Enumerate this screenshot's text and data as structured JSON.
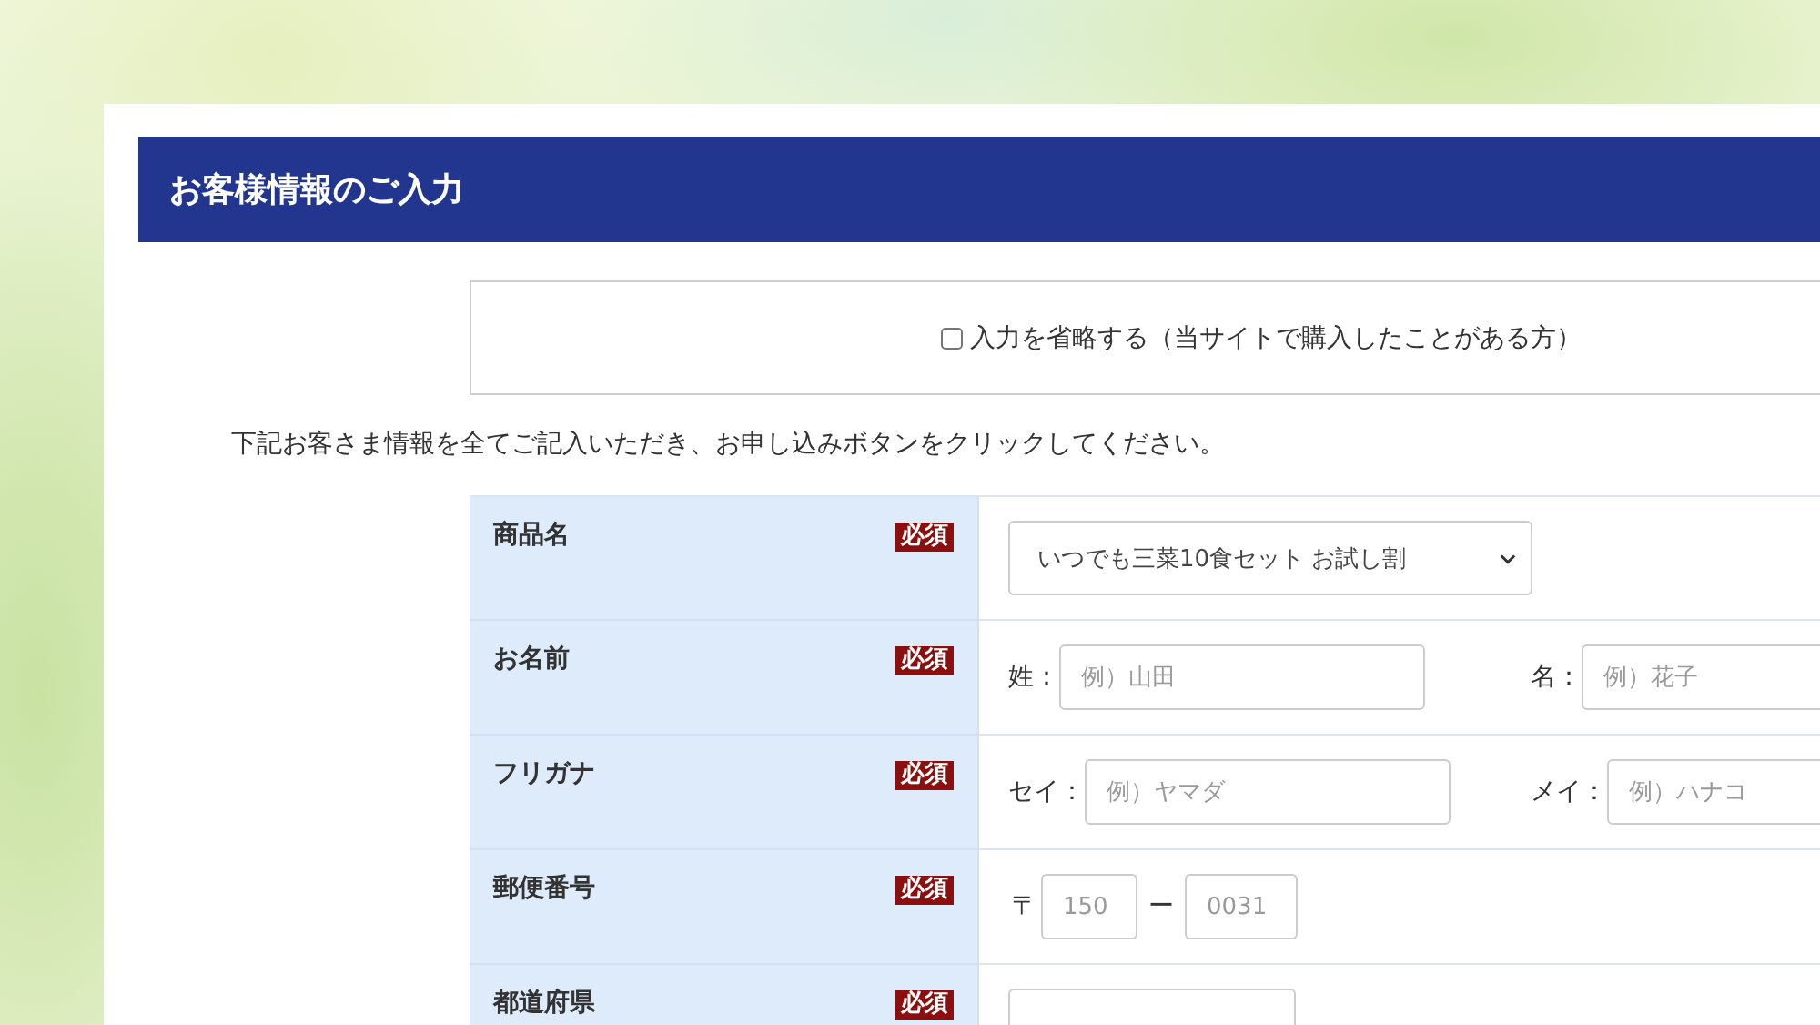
{
  "page_title": "お客様情報のご入力",
  "skip_input": {
    "label": "入力を省略する（当サイトで購入したことがある方）",
    "checked": false
  },
  "instructions": "下記お客さま情報を全てご記入いただき、お申し込みボタンをクリックしてください。",
  "form_rows": [
    {
      "label": "商品名",
      "badge": "必須",
      "kind": "select",
      "value": "いつでも三菜10食セット お試し割"
    },
    {
      "label": "お名前",
      "badge": "必須",
      "kind": "pair",
      "fields": [
        {
          "label": "姓：",
          "placeholder": "例）山田"
        },
        {
          "label": "名：",
          "placeholder": "例）花子"
        }
      ]
    },
    {
      "label": "フリガナ",
      "badge": "必須",
      "kind": "pair",
      "fields": [
        {
          "label": "セイ：",
          "placeholder": "例）ヤマダ"
        },
        {
          "label": "メイ：",
          "placeholder": "例）ハナコ"
        }
      ]
    },
    {
      "label": "郵便番号",
      "badge": "必須",
      "kind": "postal",
      "prefix": "〒",
      "separator": "ー",
      "fields": [
        {
          "placeholder": "150"
        },
        {
          "placeholder": "0031"
        }
      ]
    },
    {
      "label": "都道府県",
      "badge": "必須",
      "kind": "select"
    }
  ]
}
